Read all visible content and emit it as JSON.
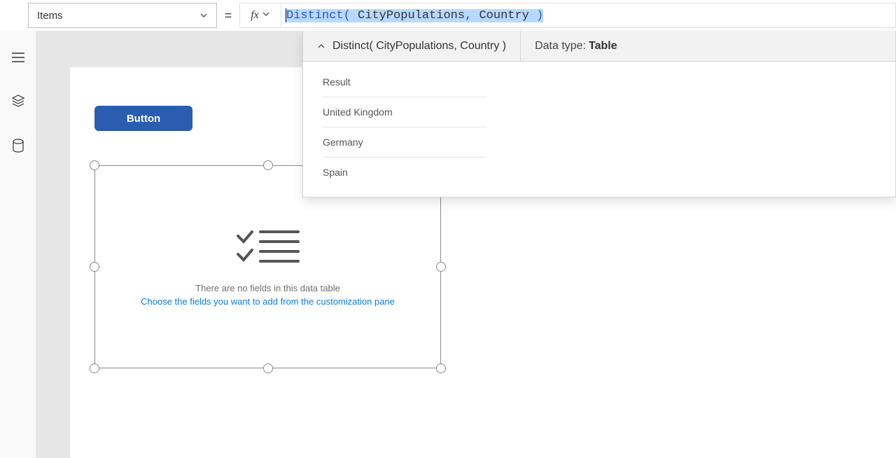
{
  "topbar": {
    "property_selected": "Items",
    "equals": "=",
    "fx_label": "fx",
    "formula": {
      "fn_open": "Distinct( ",
      "arg1": "CityPopulations",
      "sep": ", ",
      "arg2": "Country ",
      "close": ")"
    }
  },
  "suggest": {
    "signature": "Distinct( CityPopulations, Country )",
    "datatype_label": "Data type:",
    "datatype_value": "Table",
    "header_col": "Result",
    "rows": [
      "United Kingdom",
      "Germany",
      "Spain"
    ]
  },
  "sidebar": {
    "icons": [
      "hamburger-icon",
      "layers-icon",
      "cylinder-icon"
    ]
  },
  "canvas": {
    "button_label": "Button",
    "datatable_msg1": "There are no fields in this data table",
    "datatable_msg2": "Choose the fields you want to add from the customization pane"
  }
}
